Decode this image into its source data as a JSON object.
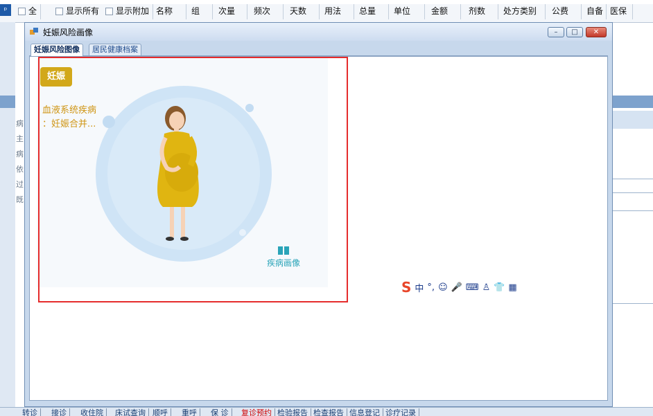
{
  "background": {
    "grid_columns": [
      "全",
      "名称",
      "组",
      "次量",
      "频次",
      "天数",
      "用法",
      "总量",
      "单位",
      "金额",
      "剂数",
      "处方类别",
      "公费",
      "自备",
      "医保"
    ],
    "show_all_label": "显示所有",
    "show_extra_label": "显示附加",
    "left_labels": [
      "病",
      "主",
      "病",
      "依",
      "过",
      "既"
    ],
    "right_cut_text": "x",
    "bottom_tabs": [
      {
        "label": "转诊",
        "highlight": false
      },
      {
        "label": "接诊",
        "highlight": false
      },
      {
        "label": "收住院",
        "highlight": false
      },
      {
        "label": "床试查询",
        "highlight": false
      },
      {
        "label": "顺呼",
        "highlight": false
      },
      {
        "label": "重呼",
        "highlight": false
      },
      {
        "label": "保 诊",
        "highlight": false
      },
      {
        "label": "复诊预约",
        "highlight": true
      },
      {
        "label": "检验报告",
        "highlight": false
      },
      {
        "label": "检查报告",
        "highlight": false
      },
      {
        "label": "信息登记",
        "highlight": false
      },
      {
        "label": "诊疗记录",
        "highlight": false
      }
    ]
  },
  "dialog": {
    "title": "妊娠风险画像",
    "tabs": [
      {
        "label": "妊娠风险图像",
        "active": true
      },
      {
        "label": "居民健康档案",
        "active": false
      }
    ],
    "badge": "妊娠",
    "disease_line1": "血液系统疾病",
    "disease_line2": "：妊娠合并...",
    "portrait_link": "疾病画像"
  },
  "ime": {
    "logo": "S",
    "mode": "中",
    "punct": "°,",
    "icons": [
      "smile-icon",
      "microphone-icon",
      "keyboard-icon",
      "user-icon",
      "shirt-icon",
      "grid-icon"
    ]
  },
  "colors": {
    "badge": "#d2a81a",
    "disease_text": "#cf9513",
    "link": "#2aa4b8",
    "highlight_frame": "#e52b2b",
    "dress": "#e0b511"
  }
}
